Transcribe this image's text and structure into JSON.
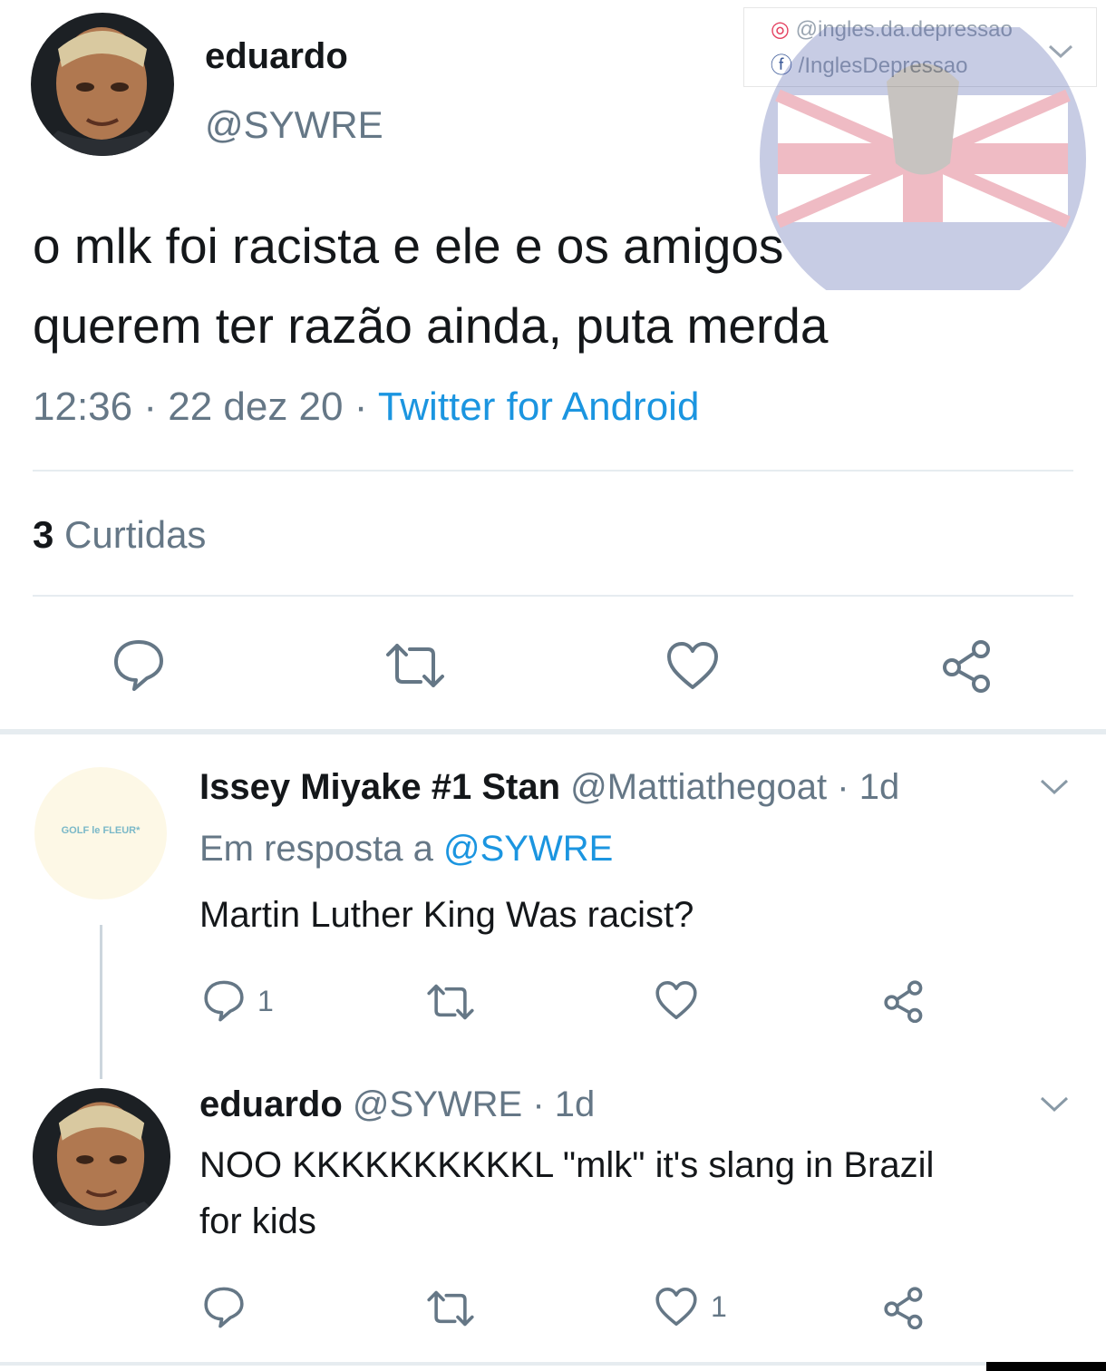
{
  "watermark": {
    "instagram": "@ingles.da.depressao",
    "facebook": "/InglesDepressao"
  },
  "main_tweet": {
    "name": "eduardo",
    "handle": "@SYWRE",
    "text_line1": "o mlk foi racista e ele e os amigos",
    "text_line2": "querem ter razão ainda, puta merda",
    "time": "12:36",
    "date": "22 dez 20",
    "source": "Twitter for Android",
    "likes_count": "3",
    "likes_label": "Curtidas",
    "actions": {
      "reply_icon": "reply-icon",
      "retweet_icon": "retweet-icon",
      "like_icon": "heart-icon",
      "share_icon": "share-icon"
    }
  },
  "reply1": {
    "name": "Issey Miyake #1 Stan",
    "handle": "@Mattiathegoat",
    "time": "1d",
    "in_reply_label": "Em resposta a",
    "in_reply_mention": "@SYWRE",
    "text": "Martin Luther King Was racist?",
    "avatar_text": "GOLF le FLEUR*",
    "reply_count": "1",
    "like_count": ""
  },
  "reply2": {
    "name": "eduardo",
    "handle": "@SYWRE",
    "time": "1d",
    "text_line1": "NOO KKKKKKKKKKL \"mlk\" it's slang in Brazil",
    "text_line2": "for kids",
    "reply_count": "",
    "like_count": "1"
  },
  "separator": " · ",
  "colors": {
    "link": "#1b95e0",
    "secondary": "#657786",
    "primary_text": "#14171a",
    "divider": "#e6ecf0"
  }
}
